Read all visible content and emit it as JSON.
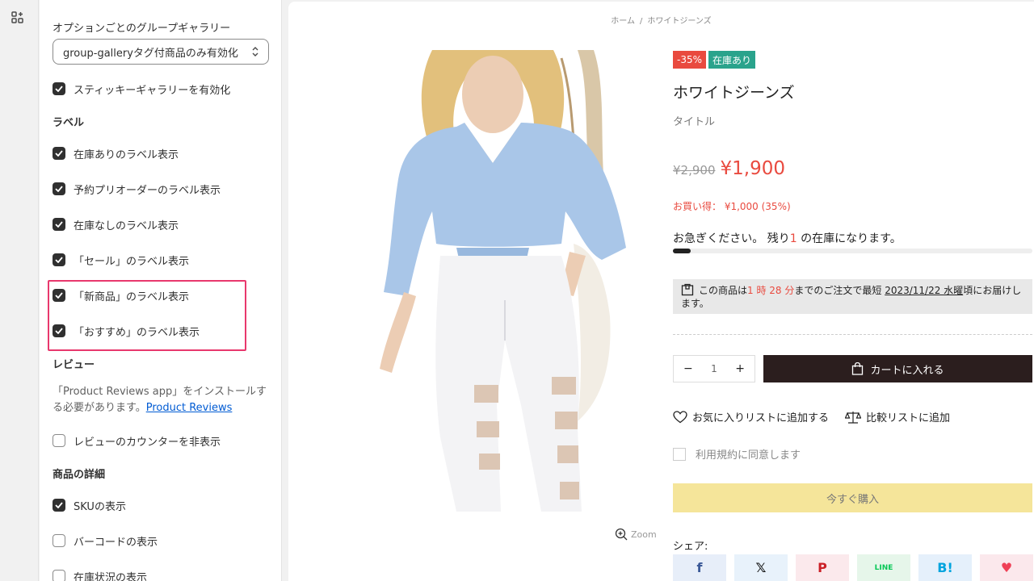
{
  "settings": {
    "group_gallery_label": "オプションごとのグループギャラリー",
    "group_gallery_value": "group-galleryタグ付商品のみ有効化",
    "sticky_gallery": "スティッキーギャラリーを有効化",
    "labels_heading": "ラベル",
    "label_items": [
      {
        "label": "在庫ありのラベル表示",
        "checked": true
      },
      {
        "label": "予約プリオーダーのラベル表示",
        "checked": true
      },
      {
        "label": "在庫なしのラベル表示",
        "checked": true
      },
      {
        "label": "「セール」のラベル表示",
        "checked": true
      },
      {
        "label": "「新商品」のラベル表示",
        "checked": true
      },
      {
        "label": "「おすすめ」のラベル表示",
        "checked": true
      }
    ],
    "review_heading": "レビュー",
    "review_note": "「Product Reviews app」をインストールする必要があります。",
    "review_link": "Product Reviews",
    "review_counter": "レビューのカウンターを非表示",
    "details_heading": "商品の詳細",
    "detail_items": [
      {
        "label": "SKUの表示",
        "checked": true
      },
      {
        "label": "バーコードの表示",
        "checked": false
      },
      {
        "label": "在庫状況の表示",
        "checked": false
      }
    ]
  },
  "preview": {
    "breadcrumb": {
      "home": "ホーム",
      "sep": "/",
      "current": "ホワイトジーンズ"
    },
    "zoom_label": "Zoom",
    "badge_sale": "-35%",
    "badge_stock": "在庫あり",
    "title": "ホワイトジーンズ",
    "subtitle": "タイトル",
    "price_old": "¥2,900",
    "price_new": "¥1,900",
    "savings": "お買い得： ¥1,000 (35%)",
    "hurry_pre": "お急ぎください。 残り",
    "hurry_count": "1",
    "hurry_post": " の在庫になります。",
    "stock_fraction": 0.05,
    "ship_pre": "この商品は",
    "ship_time": "1 時 28 分",
    "ship_mid": "までのご注文で最短 ",
    "ship_date": "2023/11/22 水曜",
    "ship_post": "頃にお届けします。",
    "qty_minus": "−",
    "qty_value": "1",
    "qty_plus": "+",
    "add_to_cart": "カートに入れる",
    "wishlist": "お気に入りリストに追加する",
    "compare": "比較リストに追加",
    "agree": "利用規約に同意します",
    "buy_now": "今すぐ購入",
    "share_label": "シェア:",
    "share_buttons": [
      {
        "name": "facebook",
        "glyph": "f",
        "bg": "#e7eef9",
        "fg": "#3b5998"
      },
      {
        "name": "x",
        "glyph": "𝕏",
        "bg": "#e8f2fb",
        "fg": "#111111"
      },
      {
        "name": "pinterest",
        "glyph": "P",
        "bg": "#fbe9ec",
        "fg": "#cb2027"
      },
      {
        "name": "line",
        "glyph": "LINE",
        "bg": "#e6f6ea",
        "fg": "#06c755"
      },
      {
        "name": "hatena",
        "glyph": "B!",
        "bg": "#e5f0fb",
        "fg": "#00a4de"
      },
      {
        "name": "pocket",
        "glyph": "♥",
        "bg": "#fbe8ec",
        "fg": "#ef4056"
      }
    ]
  },
  "colors": {
    "accent_red": "#e94a3f",
    "stock_green": "#2aa38c",
    "highlight": "#e8386d",
    "link": "#005bd3"
  }
}
